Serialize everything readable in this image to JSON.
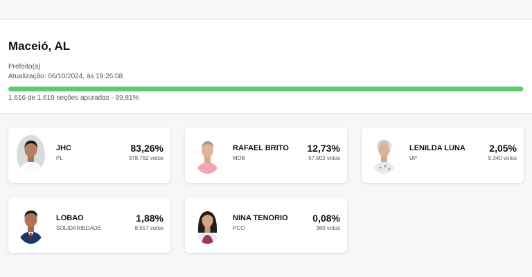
{
  "summary": {
    "city": "Maceió, AL",
    "office": "Prefeito(a)",
    "updated": "Atualização: 06/10/2024, às 19:26:08",
    "progress_fraction": 0.9981,
    "progress_color": "#5fca6a",
    "sections_text": "1.616 de 1.619 seções apuradas - 99,81%"
  },
  "candidates": [
    {
      "name": "JHC",
      "party": "PL",
      "percent": "83,26%",
      "votes": "378.762 votos",
      "avatar_icon": "candidate-photo"
    },
    {
      "name": "RAFAEL BRITO",
      "party": "MDB",
      "percent": "12,73%",
      "votes": "57.902 votos",
      "avatar_icon": "candidate-photo"
    },
    {
      "name": "LENILDA LUNA",
      "party": "UP",
      "percent": "2,05%",
      "votes": "9.340 votos",
      "avatar_icon": "candidate-photo"
    },
    {
      "name": "LOBAO",
      "party": "SOLIDARIEDADE",
      "percent": "1,88%",
      "votes": "8.557 votos",
      "avatar_icon": "candidate-photo"
    },
    {
      "name": "NINA TENORIO",
      "party": "PCO",
      "percent": "0,08%",
      "votes": "360 votos",
      "avatar_icon": "candidate-photo"
    }
  ]
}
